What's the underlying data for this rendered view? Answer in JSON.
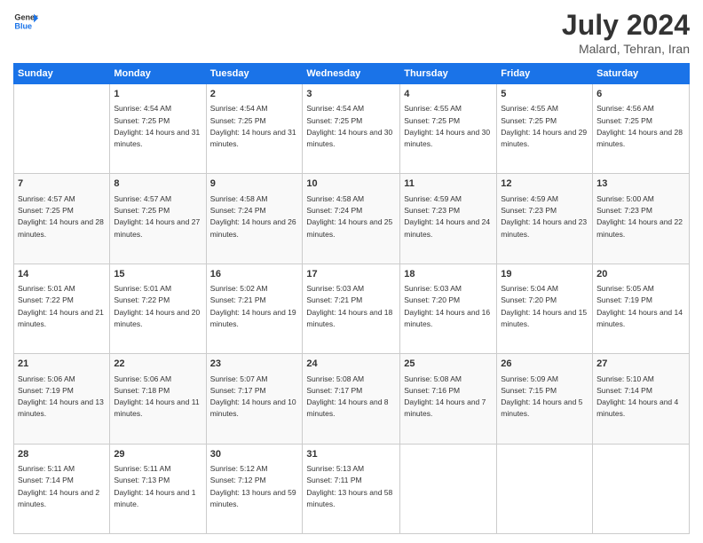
{
  "header": {
    "logo_line1": "General",
    "logo_line2": "Blue",
    "month": "July 2024",
    "location": "Malard, Tehran, Iran"
  },
  "weekdays": [
    "Sunday",
    "Monday",
    "Tuesday",
    "Wednesday",
    "Thursday",
    "Friday",
    "Saturday"
  ],
  "weeks": [
    [
      {
        "date": "",
        "info": ""
      },
      {
        "date": "1",
        "info": "Sunrise: 4:54 AM\nSunset: 7:25 PM\nDaylight: 14 hours and 31 minutes."
      },
      {
        "date": "2",
        "info": "Sunrise: 4:54 AM\nSunset: 7:25 PM\nDaylight: 14 hours and 31 minutes."
      },
      {
        "date": "3",
        "info": "Sunrise: 4:54 AM\nSunset: 7:25 PM\nDaylight: 14 hours and 30 minutes."
      },
      {
        "date": "4",
        "info": "Sunrise: 4:55 AM\nSunset: 7:25 PM\nDaylight: 14 hours and 30 minutes."
      },
      {
        "date": "5",
        "info": "Sunrise: 4:55 AM\nSunset: 7:25 PM\nDaylight: 14 hours and 29 minutes."
      },
      {
        "date": "6",
        "info": "Sunrise: 4:56 AM\nSunset: 7:25 PM\nDaylight: 14 hours and 28 minutes."
      }
    ],
    [
      {
        "date": "7",
        "info": "Sunrise: 4:57 AM\nSunset: 7:25 PM\nDaylight: 14 hours and 28 minutes."
      },
      {
        "date": "8",
        "info": "Sunrise: 4:57 AM\nSunset: 7:25 PM\nDaylight: 14 hours and 27 minutes."
      },
      {
        "date": "9",
        "info": "Sunrise: 4:58 AM\nSunset: 7:24 PM\nDaylight: 14 hours and 26 minutes."
      },
      {
        "date": "10",
        "info": "Sunrise: 4:58 AM\nSunset: 7:24 PM\nDaylight: 14 hours and 25 minutes."
      },
      {
        "date": "11",
        "info": "Sunrise: 4:59 AM\nSunset: 7:23 PM\nDaylight: 14 hours and 24 minutes."
      },
      {
        "date": "12",
        "info": "Sunrise: 4:59 AM\nSunset: 7:23 PM\nDaylight: 14 hours and 23 minutes."
      },
      {
        "date": "13",
        "info": "Sunrise: 5:00 AM\nSunset: 7:23 PM\nDaylight: 14 hours and 22 minutes."
      }
    ],
    [
      {
        "date": "14",
        "info": "Sunrise: 5:01 AM\nSunset: 7:22 PM\nDaylight: 14 hours and 21 minutes."
      },
      {
        "date": "15",
        "info": "Sunrise: 5:01 AM\nSunset: 7:22 PM\nDaylight: 14 hours and 20 minutes."
      },
      {
        "date": "16",
        "info": "Sunrise: 5:02 AM\nSunset: 7:21 PM\nDaylight: 14 hours and 19 minutes."
      },
      {
        "date": "17",
        "info": "Sunrise: 5:03 AM\nSunset: 7:21 PM\nDaylight: 14 hours and 18 minutes."
      },
      {
        "date": "18",
        "info": "Sunrise: 5:03 AM\nSunset: 7:20 PM\nDaylight: 14 hours and 16 minutes."
      },
      {
        "date": "19",
        "info": "Sunrise: 5:04 AM\nSunset: 7:20 PM\nDaylight: 14 hours and 15 minutes."
      },
      {
        "date": "20",
        "info": "Sunrise: 5:05 AM\nSunset: 7:19 PM\nDaylight: 14 hours and 14 minutes."
      }
    ],
    [
      {
        "date": "21",
        "info": "Sunrise: 5:06 AM\nSunset: 7:19 PM\nDaylight: 14 hours and 13 minutes."
      },
      {
        "date": "22",
        "info": "Sunrise: 5:06 AM\nSunset: 7:18 PM\nDaylight: 14 hours and 11 minutes."
      },
      {
        "date": "23",
        "info": "Sunrise: 5:07 AM\nSunset: 7:17 PM\nDaylight: 14 hours and 10 minutes."
      },
      {
        "date": "24",
        "info": "Sunrise: 5:08 AM\nSunset: 7:17 PM\nDaylight: 14 hours and 8 minutes."
      },
      {
        "date": "25",
        "info": "Sunrise: 5:08 AM\nSunset: 7:16 PM\nDaylight: 14 hours and 7 minutes."
      },
      {
        "date": "26",
        "info": "Sunrise: 5:09 AM\nSunset: 7:15 PM\nDaylight: 14 hours and 5 minutes."
      },
      {
        "date": "27",
        "info": "Sunrise: 5:10 AM\nSunset: 7:14 PM\nDaylight: 14 hours and 4 minutes."
      }
    ],
    [
      {
        "date": "28",
        "info": "Sunrise: 5:11 AM\nSunset: 7:14 PM\nDaylight: 14 hours and 2 minutes."
      },
      {
        "date": "29",
        "info": "Sunrise: 5:11 AM\nSunset: 7:13 PM\nDaylight: 14 hours and 1 minute."
      },
      {
        "date": "30",
        "info": "Sunrise: 5:12 AM\nSunset: 7:12 PM\nDaylight: 13 hours and 59 minutes."
      },
      {
        "date": "31",
        "info": "Sunrise: 5:13 AM\nSunset: 7:11 PM\nDaylight: 13 hours and 58 minutes."
      },
      {
        "date": "",
        "info": ""
      },
      {
        "date": "",
        "info": ""
      },
      {
        "date": "",
        "info": ""
      }
    ]
  ]
}
